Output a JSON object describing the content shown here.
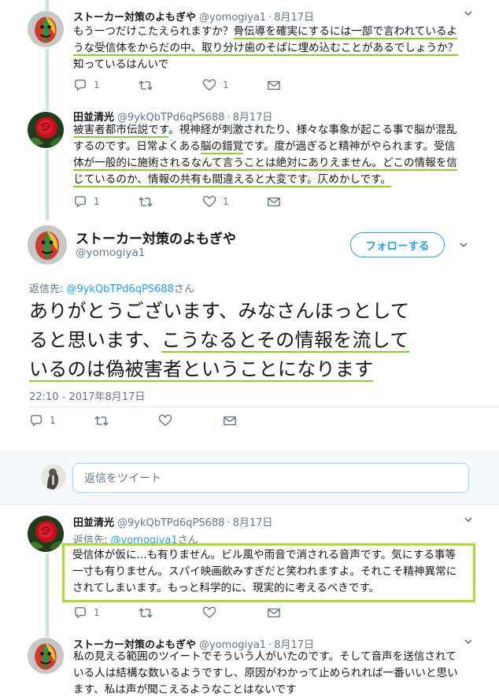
{
  "tweet1": {
    "name": "ストーカー対策のよもぎや",
    "handle": "@yomogiya1",
    "date": "8月17日",
    "lines": [
      [
        "もう一つだけこたえられますか？",
        "骨伝導を確実にするには一部で言われているよ",
        ""
      ],
      [
        "",
        "うな受信体をからだの中、取り分け歯のそばに埋め込むことがあるでしょうか？",
        ""
      ],
      [
        "知っているはんいで",
        "",
        ""
      ]
    ],
    "reply_count": "1",
    "like_count": "1"
  },
  "tweet2": {
    "name": "田並清光",
    "handle": "@9ykQbTPd6qPS688",
    "date": "8月17日",
    "lines": [
      [
        "",
        "被害者都市伝説です",
        "。視神経が刺激されたり、様々な事象が起こる事で脳が混乱"
      ],
      [
        "するのです。日常よくある",
        "脳の錯覚",
        "です。度が過ぎると精神がやられます。受信"
      ],
      [
        "",
        "体が一般的に施術されるなんて言うことは絶対にありえません。どこの情報を信",
        ""
      ],
      [
        "",
        "じているのか、情報の共有も間違えると大変です。仄めかしです。",
        ""
      ]
    ],
    "reply_count": "1",
    "like_count": "1"
  },
  "main_tweet": {
    "name": "ストーカー対策のよもぎや",
    "handle": "@yomogiya1",
    "follow_label": "フォローする",
    "reply_label": "返信先:",
    "reply_target": "@9ykQbTPd6qPS688",
    "reply_suffix": "さん",
    "line1": "ありがとうございます、みなさんほっとして",
    "line2_plain": "ると思います、",
    "line2_u": "こうなるとその情報を流して",
    "line3_u": "いるのは偽被害者ということになります",
    "timestamp": "22:10 - 2017年8月17日",
    "reply_count": "1"
  },
  "reply_box": {
    "placeholder": "返信をツイート"
  },
  "tweet3": {
    "name": "田並清光",
    "handle": "@9ykQbTPd6qPS688",
    "date": "8月17日",
    "reply_label": "返信先:",
    "reply_target": "@yomogiya1",
    "reply_suffix": "さん",
    "lines": [
      "受信体が仮に...も有りません。ビル風や雨音で消される音声です。気にする事等",
      "一寸も有りません。スパイ映画飲みすぎだと笑われますよ。それこそ精神異常に",
      "されてしまいます。もっと科学的に、現実的に考えるべきです。"
    ],
    "reply_count": "1"
  },
  "tweet4": {
    "name": "ストーカー対策のよもぎや",
    "handle": "@yomogiya1",
    "date": "8月17日",
    "lines": [
      "私の見える範囲のツイートでそういう人がいたのです。そして音声を送信されて",
      "いる人は結構な数いるようですし、原因がわかって止められれば一番いいと思い",
      "ます、私は声が聞こえるようなことはないです"
    ]
  },
  "colors": {
    "link": "#1da1f2",
    "underline": "#8ccf2a",
    "highlight_box": "#aadd33",
    "thread_line": "#c4ecd0",
    "gray": "#657786"
  },
  "icons": [
    "chevron-down-icon",
    "reply-icon",
    "retweet-icon",
    "heart-icon",
    "mail-icon"
  ]
}
